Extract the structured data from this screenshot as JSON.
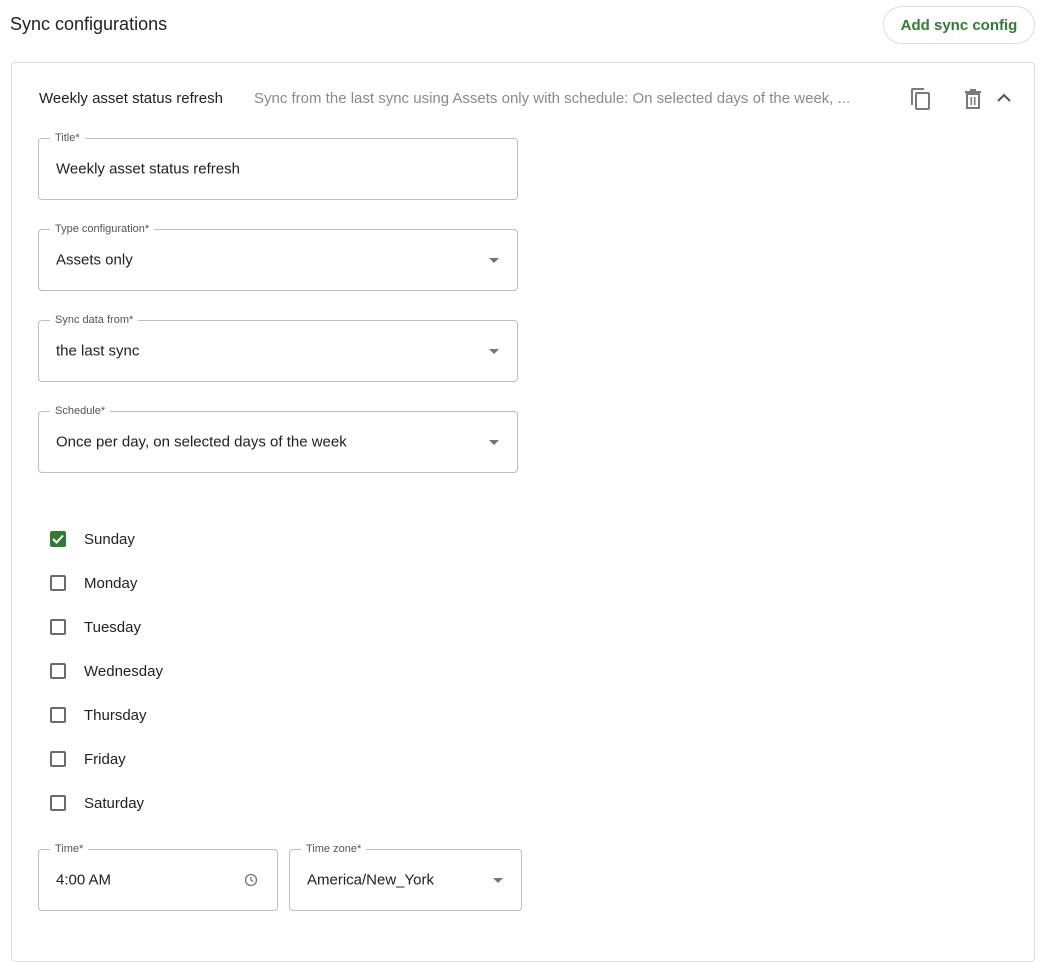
{
  "page": {
    "title": "Sync configurations",
    "add_button_label": "Add sync config"
  },
  "config": {
    "header_title": "Weekly asset status refresh",
    "header_summary": "Sync from the last sync using Assets only with schedule: On selected days of the week, ...",
    "icons": {
      "copy": "copy-icon",
      "delete": "trash-icon",
      "collapse": "chevron-up-icon"
    },
    "fields": {
      "title": {
        "label": "Title*",
        "value": "Weekly asset status refresh"
      },
      "type_configuration": {
        "label": "Type configuration*",
        "value": "Assets only"
      },
      "sync_data_from": {
        "label": "Sync data from*",
        "value": "the last sync"
      },
      "schedule": {
        "label": "Schedule*",
        "value": "Once per day, on selected days of the week"
      },
      "time": {
        "label": "Time*",
        "value": "4:00 AM"
      },
      "time_zone": {
        "label": "Time zone*",
        "value": "America/New_York"
      }
    },
    "days": [
      {
        "label": "Sunday",
        "checked": true
      },
      {
        "label": "Monday",
        "checked": false
      },
      {
        "label": "Tuesday",
        "checked": false
      },
      {
        "label": "Wednesday",
        "checked": false
      },
      {
        "label": "Thursday",
        "checked": false
      },
      {
        "label": "Friday",
        "checked": false
      },
      {
        "label": "Saturday",
        "checked": false
      }
    ]
  },
  "colors": {
    "accent": "#2e7d32",
    "border": "#bdbdbd",
    "muted_text": "#8a8a8a"
  }
}
